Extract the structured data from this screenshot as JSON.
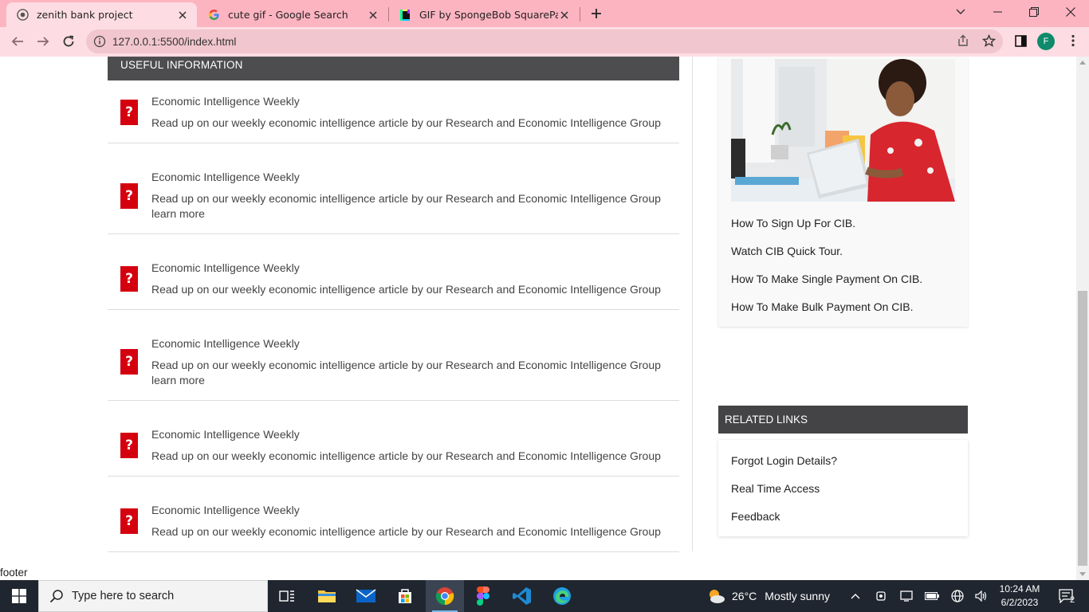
{
  "browser": {
    "tabs": [
      {
        "title": "zenith bank project",
        "favicon": "globe-icon",
        "active": true
      },
      {
        "title": "cute gif - Google Search",
        "favicon": "google-icon",
        "active": false
      },
      {
        "title": "GIF by SpongeBob SquarePants -",
        "favicon": "giphy-icon",
        "active": false
      }
    ],
    "url": "127.0.0.1:5500/index.html",
    "profile_initial": "F"
  },
  "page": {
    "useful_header": "USEFUL INFORMATION",
    "info_items": [
      {
        "icon": "?",
        "title": "Economic Intelligence Weekly",
        "desc": "Read up on our weekly economic intelligence article by our Research and Economic Intelligence Group",
        "more": ""
      },
      {
        "icon": "?",
        "title": "Economic Intelligence Weekly",
        "desc": "Read up on our weekly economic intelligence article by our Research and Economic Intelligence Group",
        "more": "learn more"
      },
      {
        "icon": "?",
        "title": "Economic Intelligence Weekly",
        "desc": "Read up on our weekly economic intelligence article by our Research and Economic Intelligence Group",
        "more": ""
      },
      {
        "icon": "?",
        "title": "Economic Intelligence Weekly",
        "desc": "Read up on our weekly economic intelligence article by our Research and Economic Intelligence Group",
        "more": "learn more"
      },
      {
        "icon": "?",
        "title": "Economic Intelligence Weekly",
        "desc": "Read up on our weekly economic intelligence article by our Research and Economic Intelligence Group",
        "more": ""
      },
      {
        "icon": "?",
        "title": "Economic Intelligence Weekly",
        "desc": "Read up on our weekly economic intelligence article by our Research and Economic Intelligence Group",
        "more": ""
      }
    ],
    "cib_links": [
      "How To Sign Up For CIB.",
      "Watch CIB Quick Tour.",
      "How To Make Single Payment On CIB.",
      "How To Make Bulk Payment On CIB."
    ],
    "related_header": "RELATED LINKS",
    "related_links": [
      "Forgot Login Details?",
      "Real Time Access",
      "Feedback"
    ],
    "footer": "footer"
  },
  "taskbar": {
    "search_placeholder": "Type here to search",
    "weather_temp": "26°C",
    "weather_desc": "Mostly sunny",
    "time": "10:24 AM",
    "date": "6/2/2023",
    "notification_count": "2"
  },
  "colors": {
    "tab_bar": "#fdb4c1",
    "toolbar": "#fddde3",
    "header_dark": "#4d4d4f",
    "icon_red": "#d4000f",
    "taskbar": "#1f2630"
  }
}
